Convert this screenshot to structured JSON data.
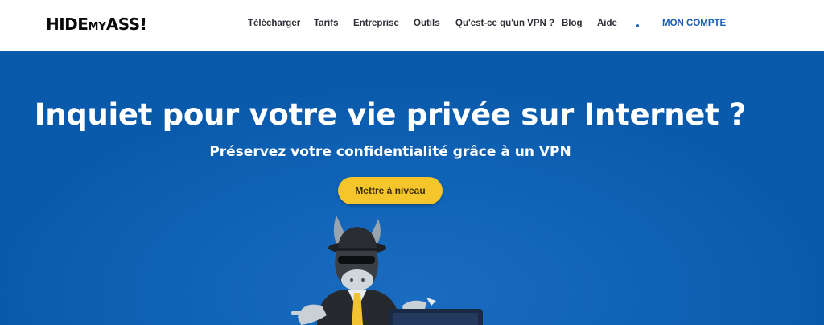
{
  "header": {
    "logo": {
      "part1": "HIDE",
      "part2": "MY",
      "part3": "ASS!"
    },
    "nav": [
      {
        "label": "Télécharger"
      },
      {
        "label": "Tarifs"
      },
      {
        "label": "Entreprise"
      },
      {
        "label": "Outils"
      },
      {
        "label": "Qu'est-ce qu'un VPN ?"
      },
      {
        "label": "Blog"
      },
      {
        "label": "Aide"
      }
    ],
    "account_label": "MON COMPTE"
  },
  "hero": {
    "title": "Inquiet pour votre vie privée sur Internet ?",
    "subtitle": "Préservez votre confidentialité grâce à un VPN",
    "cta_label": "Mettre à niveau"
  },
  "colors": {
    "hero_blue": "#0f63b6",
    "cta_yellow": "#f5c52c",
    "accent_blue": "#1a5fb4"
  }
}
